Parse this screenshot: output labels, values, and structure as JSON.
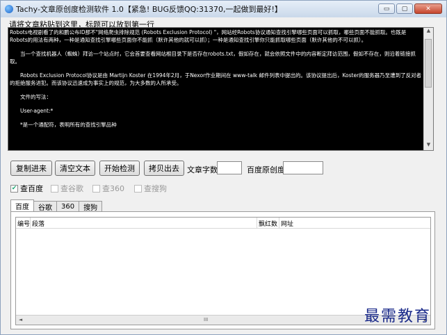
{
  "window": {
    "title": "Tachy-文章原创度检测软件 1.0【紧急! BUG反馈QQ:31370,一起做到最好!】",
    "min_icon": "minimize-icon",
    "max_icon": "maximize-icon",
    "close_icon": "close-icon",
    "min_glyph": "▭",
    "max_glyph": "▢",
    "close_glyph": "✕"
  },
  "hint": "请将文章粘贴到这里，标题可以放到第一行",
  "editor": {
    "paragraphs": [
      "Robots电视剧看了的和鹏公布ID那不\"网络爬虫排除规范 (Robots Exclusion Protocol) \"，网站经Robots协议通知查找引擎哪些页面可以抓取，哪些页面不能抓取。也既是Robots的用法有两种，一种是通知查找引擎哪些页面你不能抓（默许其他的就可以抓）；一种是通知查找引擎你只能抓取哪些页面（默许其他的不可以抓）。",
      "当一个查找机器人（蜘蛛）拜访一个站点时，它会首要查看网站根目录下是否存在robots.txt，假如存在，就会依照文件中的内容断定拜访范围，假如不存在，则沿着链接抓取。",
      "Robots Exclusion Protocol协议是由 Martijn Koster 在1994年2月，于Nexor作业期间在 www-talk 邮件列表中提出的。该协议提出后，Koster的服务器乃至遭到了反对者的拒绝服务进犯。而该协议迅速成为事实上的规范，为大多数的人所承受。",
      "文件的写法：",
      "User-agent:*",
      "*是一个通配符，表明所有的查找引擎品种"
    ]
  },
  "buttons": {
    "copy_in": "复制进来",
    "clear": "清空文本",
    "start": "开始检测",
    "copy_out": "拷贝出去"
  },
  "labels": {
    "word_count": "文章字数:",
    "originality": "百度原创度:"
  },
  "inputs": {
    "word_count_value": "",
    "originality_value": ""
  },
  "checkboxes": [
    {
      "label": "查百度",
      "checked": true,
      "enabled": true
    },
    {
      "label": "查谷歌",
      "checked": false,
      "enabled": false
    },
    {
      "label": "查360",
      "checked": false,
      "enabled": false
    },
    {
      "label": "查搜狗",
      "checked": false,
      "enabled": false
    }
  ],
  "tabs": [
    "百度",
    "谷歌",
    "360",
    "搜狗"
  ],
  "table": {
    "columns": [
      "编号",
      "段落",
      "飘红数",
      "网址"
    ],
    "rows": []
  },
  "scroll": {
    "up": "▲",
    "down": "▼",
    "left": "◄",
    "right": "►",
    "grip": "III"
  },
  "watermark": "最需教育",
  "colors": {
    "editor_bg": "#000000",
    "editor_text": "#ffffff",
    "watermark": "#1a2a8a",
    "close_button": "#c5442c"
  }
}
